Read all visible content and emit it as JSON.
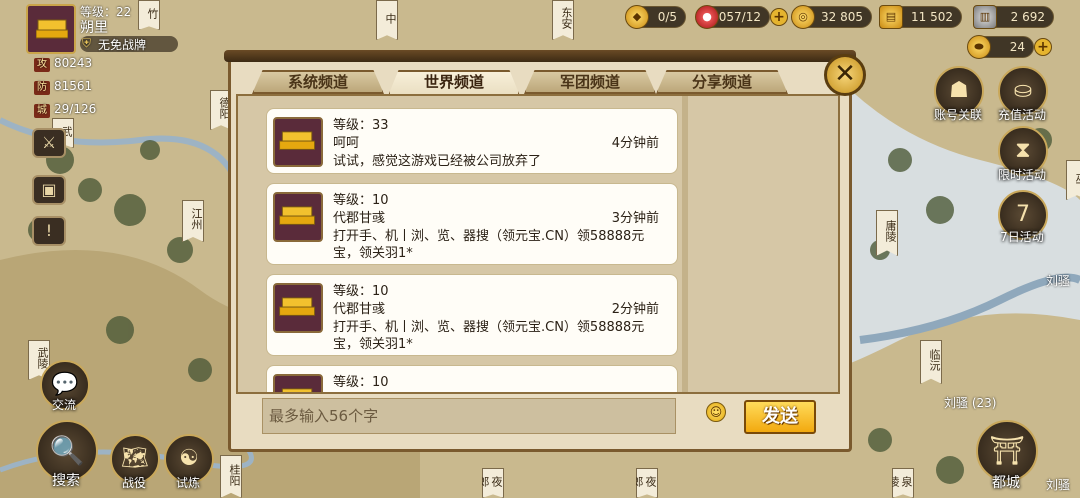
{
  "map": {
    "labels": [
      "竹",
      "中",
      "东安",
      "德阳",
      "武",
      "江州",
      "巫",
      "庸陵",
      "武陵",
      "临沅",
      "桂阳",
      "夜郎",
      "泉陵"
    ],
    "world_text": [
      "刘骚",
      "刘骚 (23)",
      "刘骚"
    ],
    "banner": "辽西青仓 1"
  },
  "player": {
    "level": "等级：22",
    "name": "朔里",
    "avoid_war": "无免战牌",
    "attack_badge": "攻",
    "attack": "80243",
    "defense_badge": "防",
    "defense": "81561",
    "city_badge": "城",
    "cities": "29/126"
  },
  "resources": {
    "r1": "0/5",
    "r2": "057/12",
    "r3": "32 805",
    "r4": "11 502",
    "r5": "2 692",
    "gold": "24"
  },
  "right_menu": {
    "account": "账号关联",
    "recharge": "充值活动",
    "limited": "限时活动",
    "seven_day": "7日活动",
    "seven_num": "7",
    "capital": "都城"
  },
  "left_menu": {
    "chat": "交流",
    "search": "搜索",
    "battle": "战役",
    "train": "试炼"
  },
  "chat": {
    "tabs": [
      "系统频道",
      "世界频道",
      "军团频道",
      "分享频道"
    ],
    "messages": [
      {
        "level": "等级：33",
        "name": "呵呵",
        "time": "4分钟前",
        "text": "试试，感觉这游戏已经被公司放弃了"
      },
      {
        "level": "等级：10",
        "name": "代郡甘彧",
        "time": "3分钟前",
        "text": "打开手、机丨浏、览、器搜（领元宝.CN）领58888元宝，领关羽1*"
      },
      {
        "level": "等级：10",
        "name": "代郡甘彧",
        "time": "2分钟前",
        "text": "打开手、机丨浏、览、器搜（领元宝.CN）领58888元宝，领关羽1*"
      },
      {
        "level": "等级：10",
        "name": "",
        "time": "",
        "text": ""
      }
    ],
    "input_placeholder": "最多输入56个字",
    "send_label": "发送"
  },
  "colors": {
    "panel_bg": "#e8dcc1",
    "accent_gold": "#f2a90f",
    "tab_active": "#f8efd9"
  }
}
